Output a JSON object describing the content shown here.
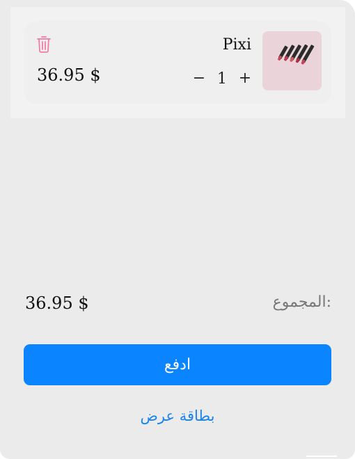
{
  "cart": {
    "items": [
      {
        "name": "Pixi",
        "price": "36.95 $",
        "quantity": "1",
        "decrement_label": "−",
        "increment_label": "+",
        "thumbnail": "lipstick-product-image",
        "delete_icon": "trash-icon"
      }
    ]
  },
  "summary": {
    "total_label": "المجموع:",
    "total_value": "36.95 $"
  },
  "actions": {
    "pay_label": "ادفع",
    "offer_card_label": "بطاقة عرض"
  },
  "colors": {
    "accent": "#0a84ff",
    "link": "#1a84ee",
    "delete_icon": "#f27aa6",
    "background": "#ebebeb"
  }
}
